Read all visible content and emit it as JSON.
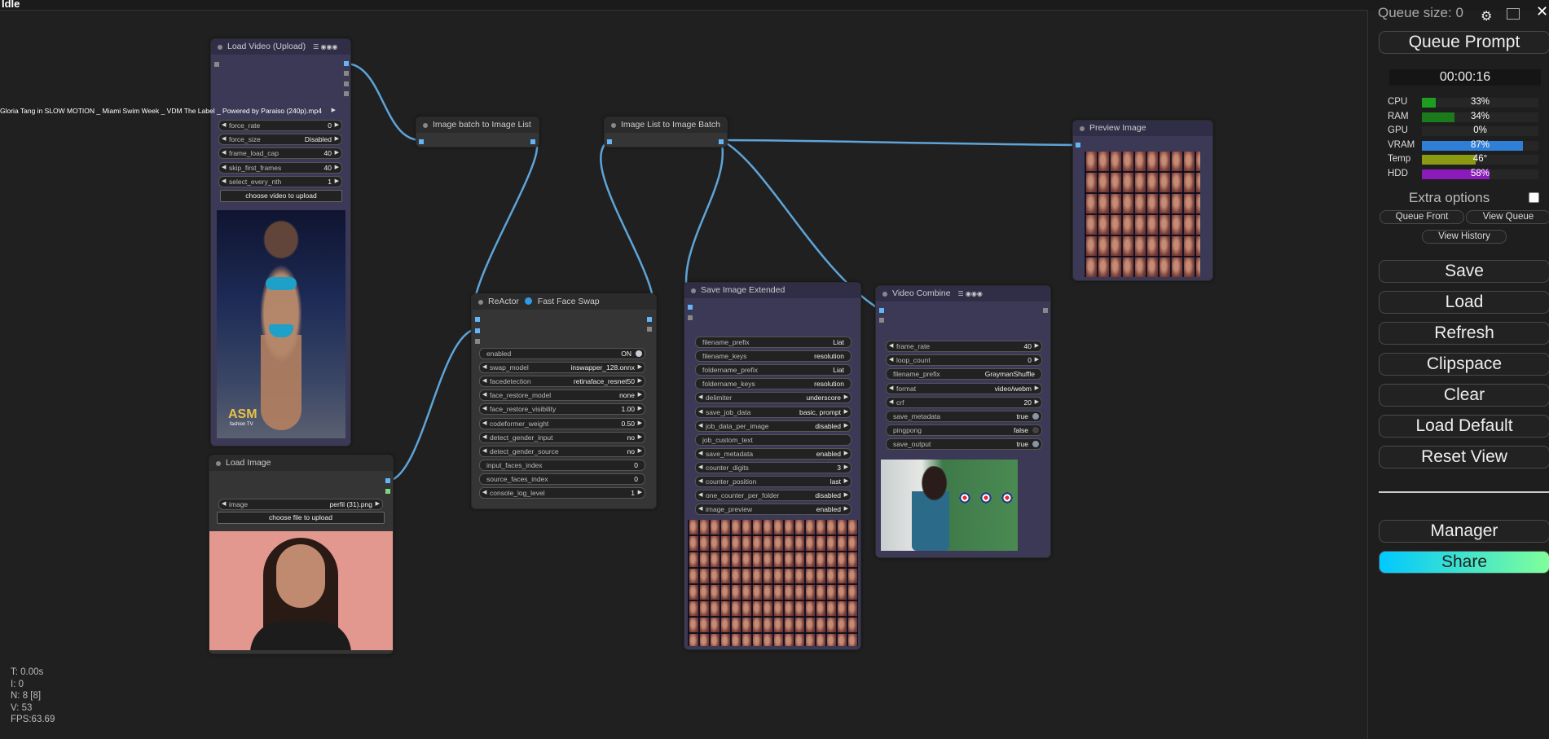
{
  "status": "Idle",
  "colors": {
    "canvas": "#202020",
    "wire": "#5ea4d8",
    "image_port": "#64b5f6",
    "cpu": "#1e9e1e",
    "ram": "#1b7a1b",
    "vram": "#2f7fd6",
    "temp": "#8a9a12",
    "hdd": "#8a1bb8",
    "share_gradient_start": "#00c8ff",
    "share_gradient_end": "#80ff9a"
  },
  "nodes": {
    "load_video": {
      "title": "Load Video (Upload)",
      "title_icons": "☰ ◉◉◉",
      "video_file": "Gloria Tang in SLOW MOTION _ Miami Swim Week _ VDM The Label _ Powered by Paraiso (240p).mp4",
      "widgets": [
        {
          "label": "force_rate",
          "value": "0"
        },
        {
          "label": "force_size",
          "value": "Disabled"
        },
        {
          "label": "frame_load_cap",
          "value": "40"
        },
        {
          "label": "skip_first_frames",
          "value": "40"
        },
        {
          "label": "select_every_nth",
          "value": "1"
        }
      ],
      "upload_button": "choose video to upload",
      "watermark": "ASM",
      "watermark_sub": "fashion TV"
    },
    "batch_to_list": {
      "title": "Image batch to Image List"
    },
    "list_to_batch": {
      "title": "Image List to Image Batch"
    },
    "preview_image": {
      "title": "Preview Image"
    },
    "reactor": {
      "title": "ReActor",
      "title_suffix": "Fast Face Swap",
      "widgets": [
        {
          "label": "enabled",
          "value": "ON",
          "kind": "toggle"
        },
        {
          "label": "swap_model",
          "value": "inswapper_128.onnx",
          "kind": "combo"
        },
        {
          "label": "facedetection",
          "value": "retinaface_resnet50",
          "kind": "combo"
        },
        {
          "label": "face_restore_model",
          "value": "none",
          "kind": "combo"
        },
        {
          "label": "face_restore_visibility",
          "value": "1.00",
          "kind": "combo"
        },
        {
          "label": "codeformer_weight",
          "value": "0.50",
          "kind": "combo"
        },
        {
          "label": "detect_gender_input",
          "value": "no",
          "kind": "combo"
        },
        {
          "label": "detect_gender_source",
          "value": "no",
          "kind": "combo"
        },
        {
          "label": "input_faces_index",
          "value": "0",
          "kind": "plain"
        },
        {
          "label": "source_faces_index",
          "value": "0",
          "kind": "plain"
        },
        {
          "label": "console_log_level",
          "value": "1",
          "kind": "combo"
        }
      ]
    },
    "save_image_extended": {
      "title": "Save Image Extended",
      "widgets": [
        {
          "label": "filename_prefix",
          "value": "Liat",
          "kind": "plain"
        },
        {
          "label": "filename_keys",
          "value": "resolution",
          "kind": "plain"
        },
        {
          "label": "foldername_prefix",
          "value": "Liat",
          "kind": "plain"
        },
        {
          "label": "foldername_keys",
          "value": "resolution",
          "kind": "plain"
        },
        {
          "label": "delimiter",
          "value": "underscore",
          "kind": "combo"
        },
        {
          "label": "save_job_data",
          "value": "basic, prompt",
          "kind": "combo"
        },
        {
          "label": "job_data_per_image",
          "value": "disabled",
          "kind": "combo"
        },
        {
          "label": "job_custom_text",
          "value": "",
          "kind": "plain"
        },
        {
          "label": "save_metadata",
          "value": "enabled",
          "kind": "combo"
        },
        {
          "label": "counter_digits",
          "value": "3",
          "kind": "combo"
        },
        {
          "label": "counter_position",
          "value": "last",
          "kind": "combo"
        },
        {
          "label": "one_counter_per_folder",
          "value": "disabled",
          "kind": "combo"
        },
        {
          "label": "image_preview",
          "value": "enabled",
          "kind": "combo"
        }
      ]
    },
    "video_combine": {
      "title": "Video Combine",
      "title_icons": "☰ ◉◉◉",
      "widgets": [
        {
          "label": "frame_rate",
          "value": "40",
          "kind": "combo"
        },
        {
          "label": "loop_count",
          "value": "0",
          "kind": "combo"
        },
        {
          "label": "filename_prefix",
          "value": "GraymanShuffle",
          "kind": "plain"
        },
        {
          "label": "format",
          "value": "video/webm",
          "kind": "combo"
        },
        {
          "label": "crf",
          "value": "20",
          "kind": "combo"
        },
        {
          "label": "save_metadata",
          "value": "true",
          "kind": "toggle"
        },
        {
          "label": "pingpong",
          "value": "false",
          "kind": "toggle_off"
        },
        {
          "label": "save_output",
          "value": "true",
          "kind": "toggle"
        }
      ]
    },
    "load_image": {
      "title": "Load Image",
      "widgets": [
        {
          "label": "image",
          "value": "perfil (31).png"
        }
      ],
      "upload_button": "choose file to upload"
    }
  },
  "panel": {
    "queue_size": "Queue size: 0",
    "queue_prompt": "Queue Prompt",
    "timer": "00:00:16",
    "stats": [
      {
        "name": "CPU",
        "percent": "33%",
        "fraction": 0.12,
        "color": "#1e9e1e"
      },
      {
        "name": "RAM",
        "percent": "34%",
        "fraction": 0.28,
        "color": "#1b7a1b"
      },
      {
        "name": "GPU",
        "percent": "0%",
        "fraction": 0.0,
        "color": "#1e9e1e"
      },
      {
        "name": "VRAM",
        "percent": "87%",
        "fraction": 0.87,
        "color": "#2f7fd6"
      },
      {
        "name": "Temp",
        "percent": "46°",
        "fraction": 0.46,
        "color": "#8a9a12"
      },
      {
        "name": "HDD",
        "percent": "58%",
        "fraction": 0.58,
        "color": "#8a1bb8"
      }
    ],
    "extra_options": "Extra options",
    "queue_front": "Queue Front",
    "view_queue": "View Queue",
    "view_history": "View History",
    "save": "Save",
    "load": "Load",
    "refresh": "Refresh",
    "clipspace": "Clipspace",
    "clear": "Clear",
    "load_default": "Load Default",
    "reset_view": "Reset View",
    "manager": "Manager",
    "share": "Share"
  },
  "canvas_stats": [
    "T: 0.00s",
    "I: 0",
    "N: 8 [8]",
    "V: 53",
    "FPS:63.69"
  ]
}
